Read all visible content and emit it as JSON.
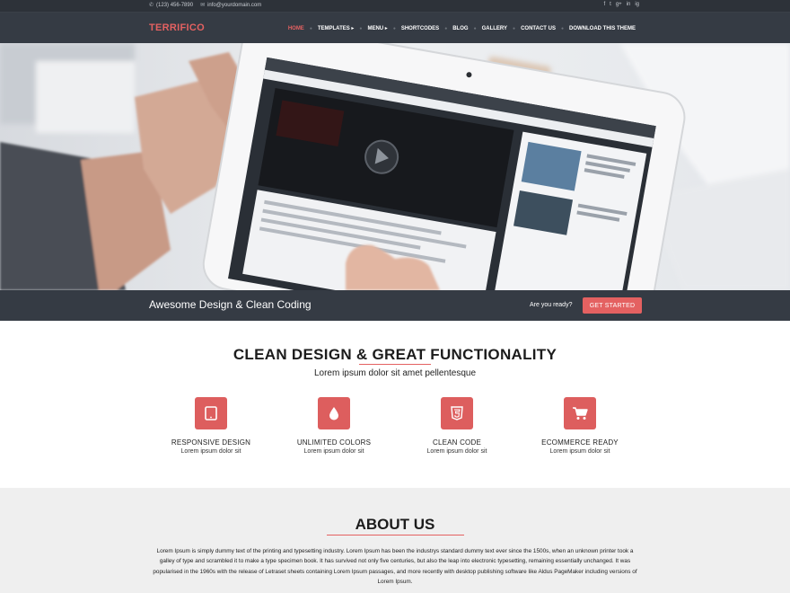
{
  "topbar": {
    "phone": "(123) 456-7890",
    "email": "info@yourdomain.com",
    "social": [
      "f",
      "t",
      "g+",
      "in",
      "ig"
    ]
  },
  "header": {
    "logo": "TERRIFICO",
    "nav": [
      {
        "label": "HOME",
        "active": true
      },
      {
        "label": "TEMPLATES ▸",
        "active": false
      },
      {
        "label": "MENU ▸",
        "active": false
      },
      {
        "label": "SHORTCODES",
        "active": false
      },
      {
        "label": "BLOG",
        "active": false
      },
      {
        "label": "GALLERY",
        "active": false
      },
      {
        "label": "CONTACT US",
        "active": false
      },
      {
        "label": "DOWNLOAD THIS THEME",
        "active": false
      }
    ]
  },
  "strip": {
    "tagline": "Awesome Design & Clean Coding",
    "ready": "Are you ready?",
    "cta": "GET STARTED"
  },
  "features": {
    "title": "CLEAN DESIGN & GREAT FUNCTIONALITY",
    "subtitle": "Lorem ipsum dolor sit amet pellentesque",
    "items": [
      {
        "title": "RESPONSIVE DESIGN",
        "desc": "Lorem ipsum dolor sit",
        "icon": "tablet-icon"
      },
      {
        "title": "UNLIMITED COLORS",
        "desc": "Lorem ipsum dolor sit",
        "icon": "droplet-icon"
      },
      {
        "title": "CLEAN CODE",
        "desc": "Lorem ipsum dolor sit",
        "icon": "html5-icon"
      },
      {
        "title": "ECOMMERCE READY",
        "desc": "Lorem ipsum dolor sit",
        "icon": "cart-icon"
      }
    ]
  },
  "about": {
    "title": "ABOUT US",
    "text": "Lorem Ipsum is simply dummy text of the printing and typesetting industry. Lorem Ipsum has been the industrys standard dummy text ever since the 1500s, when an unknown printer took a galley of type and scrambled it to make a type specimen book. It has survived not only five centuries, but also the leap into electronic typesetting, remaining essentially unchanged. It was popularised in the 1960s with the release of Letraset sheets containing Lorem Ipsum passages, and more recently with desktop publishing software like Aldus PageMaker including versions of Lorem Ipsum."
  },
  "colors": {
    "accent": "#e46161",
    "dark": "#353b44",
    "topbar": "#2d3239",
    "about_bg": "#efefef"
  }
}
